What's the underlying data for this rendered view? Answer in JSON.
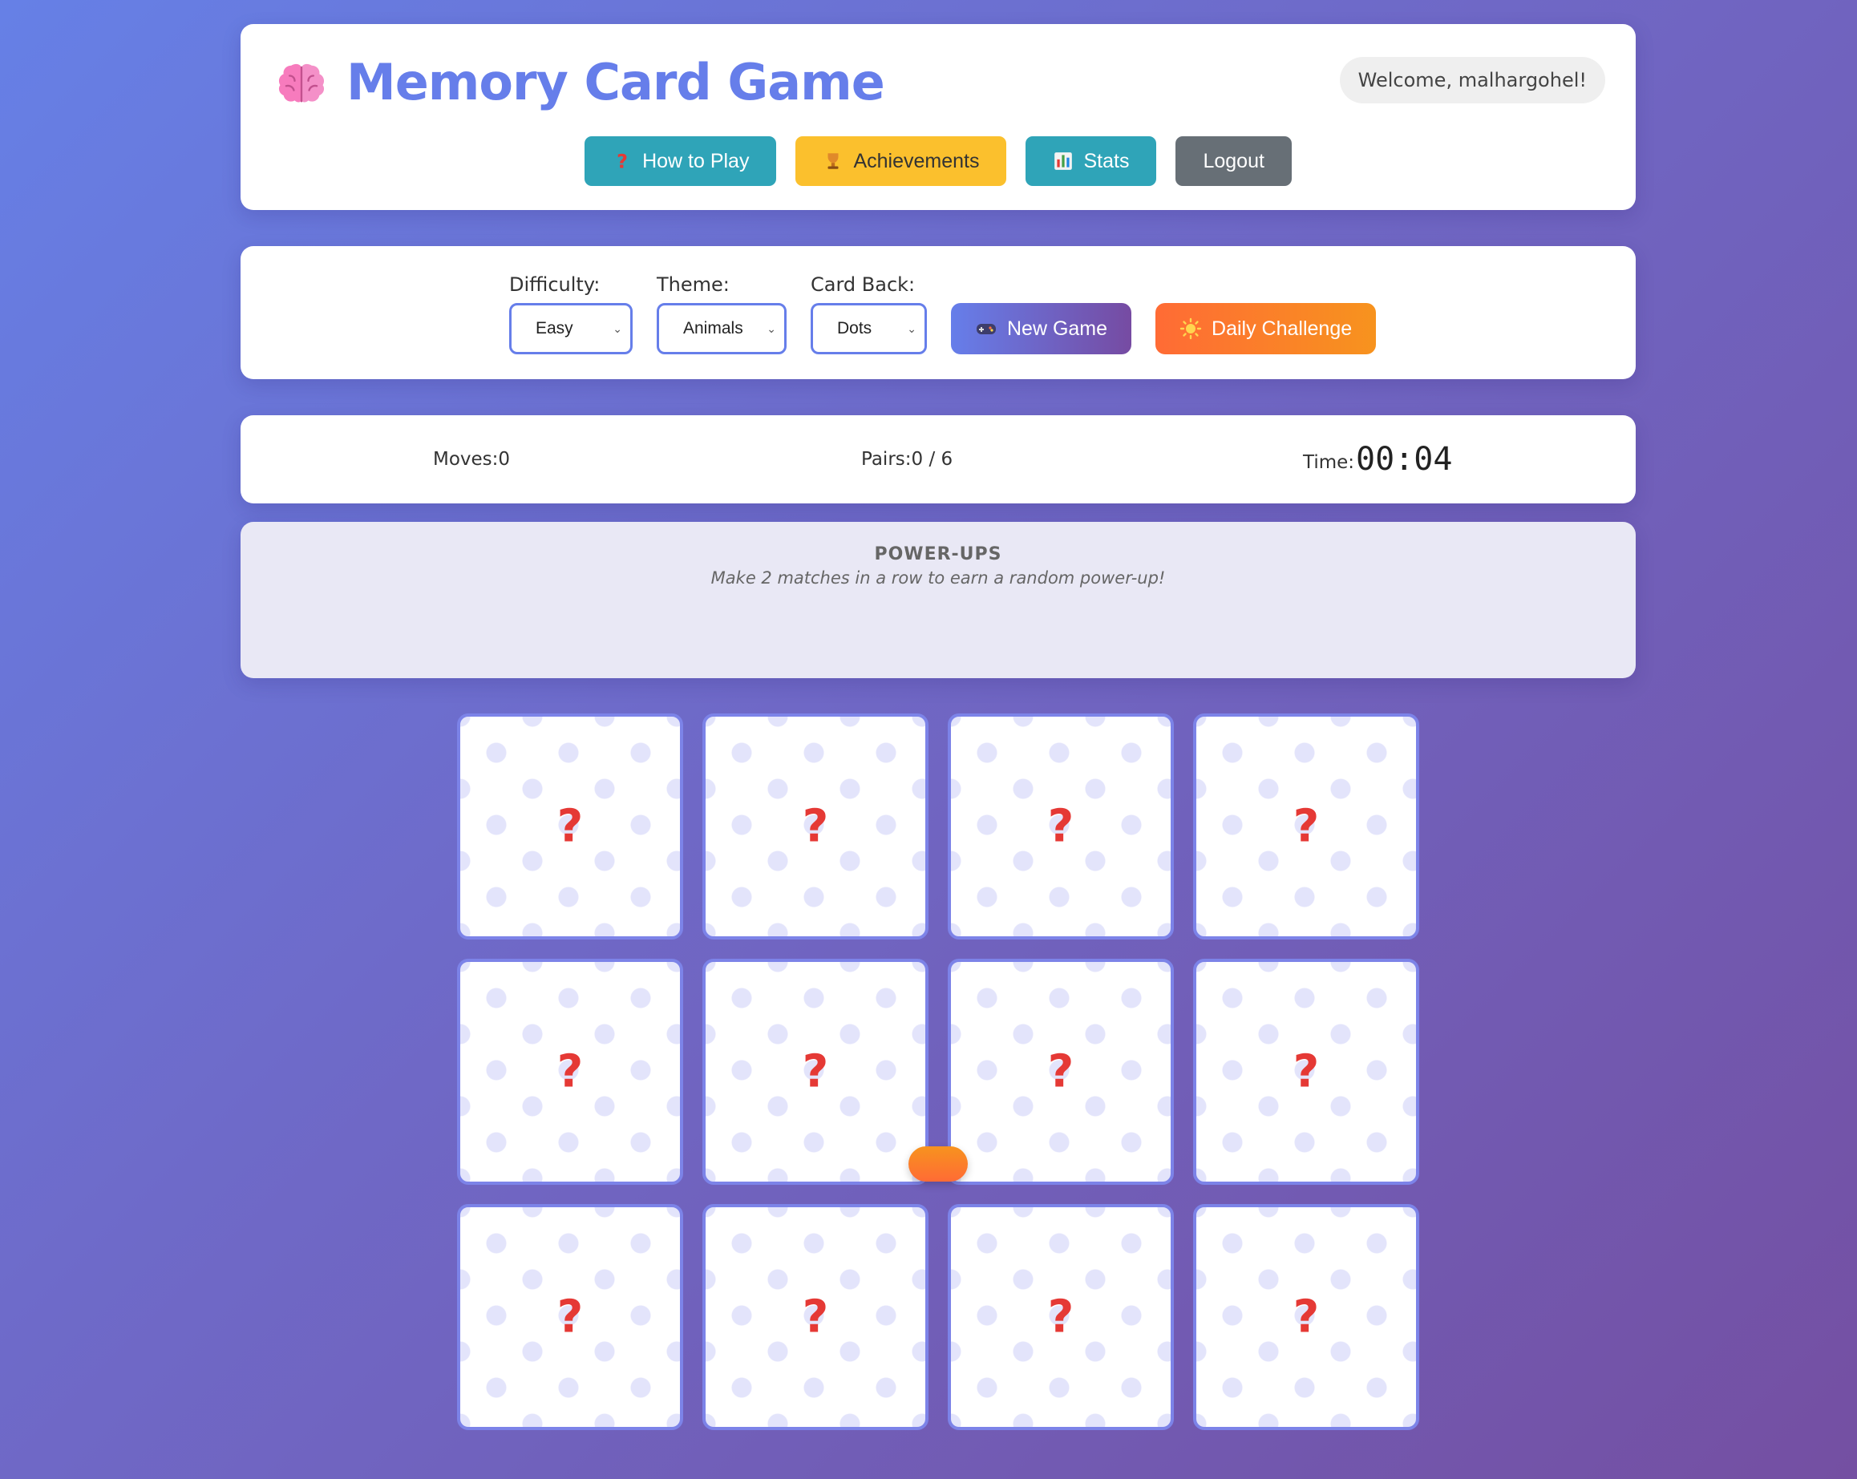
{
  "header": {
    "title": "Memory Card Game",
    "welcome": "Welcome, malhargohel!",
    "nav": {
      "how_to_play": "How to Play",
      "achievements": "Achievements",
      "stats": "Stats",
      "logout": "Logout"
    }
  },
  "controls": {
    "difficulty": {
      "label": "Difficulty:",
      "value": "Easy"
    },
    "theme": {
      "label": "Theme:",
      "value": "Animals"
    },
    "card_back": {
      "label": "Card Back:",
      "value": "Dots"
    },
    "new_game": "New Game",
    "daily_challenge": "Daily Challenge"
  },
  "stats": {
    "moves_label": "Moves:",
    "moves_value": "0",
    "pairs_label": "Pairs:",
    "pairs_value": "0 / 6",
    "time_label": "Time:",
    "time_value": "00:04"
  },
  "powerups": {
    "title": "POWER-UPS",
    "subtitle": "Make 2 matches in a row to earn a random power-up!"
  },
  "board": {
    "card_symbol": "?",
    "cards": 12
  },
  "colors": {
    "accent": "#667eea",
    "accent_dark": "#764ba2",
    "orange": "#ff6b35",
    "teal": "#2fa4b8",
    "yellow": "#fbc02d",
    "question_mark": "#e53935"
  }
}
